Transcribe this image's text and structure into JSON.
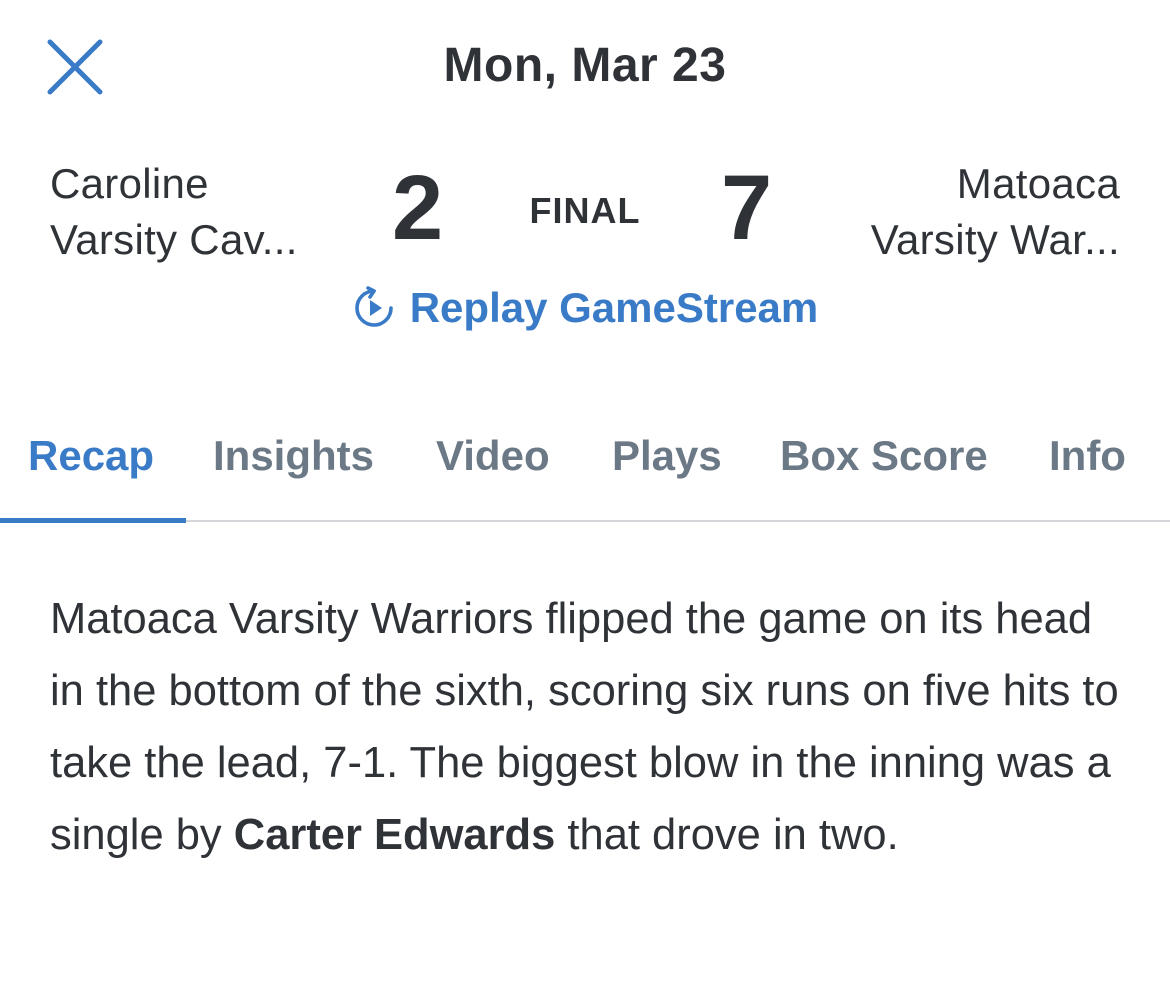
{
  "header": {
    "date": "Mon, Mar 23",
    "close_icon": "close-icon"
  },
  "game": {
    "away_team": {
      "line1": "Caroline",
      "line2": "Varsity Cav...",
      "score": "2"
    },
    "home_team": {
      "line1": "Matoaca",
      "line2": "Varsity War...",
      "score": "7"
    },
    "status": "FINAL",
    "replay_label": "Replay GameStream",
    "replay_icon": "replay-icon"
  },
  "tabs": [
    {
      "label": "Recap",
      "active": true
    },
    {
      "label": "Insights",
      "active": false
    },
    {
      "label": "Video",
      "active": false
    },
    {
      "label": "Plays",
      "active": false
    },
    {
      "label": "Box Score",
      "active": false
    },
    {
      "label": "Info",
      "active": false
    }
  ],
  "recap": {
    "text_before": "Matoaca Varsity Warriors flipped the game on its head in the bottom of the sixth, scoring six runs on five hits to take the lead, 7-1. The biggest blow in the inning was a single by ",
    "player": "Carter Edwards",
    "text_after": " that drove in two."
  },
  "colors": {
    "accent": "#3a7bc8",
    "text": "#2f3338",
    "inactive_tab": "#6b7886",
    "divider": "#d4d6d9"
  }
}
